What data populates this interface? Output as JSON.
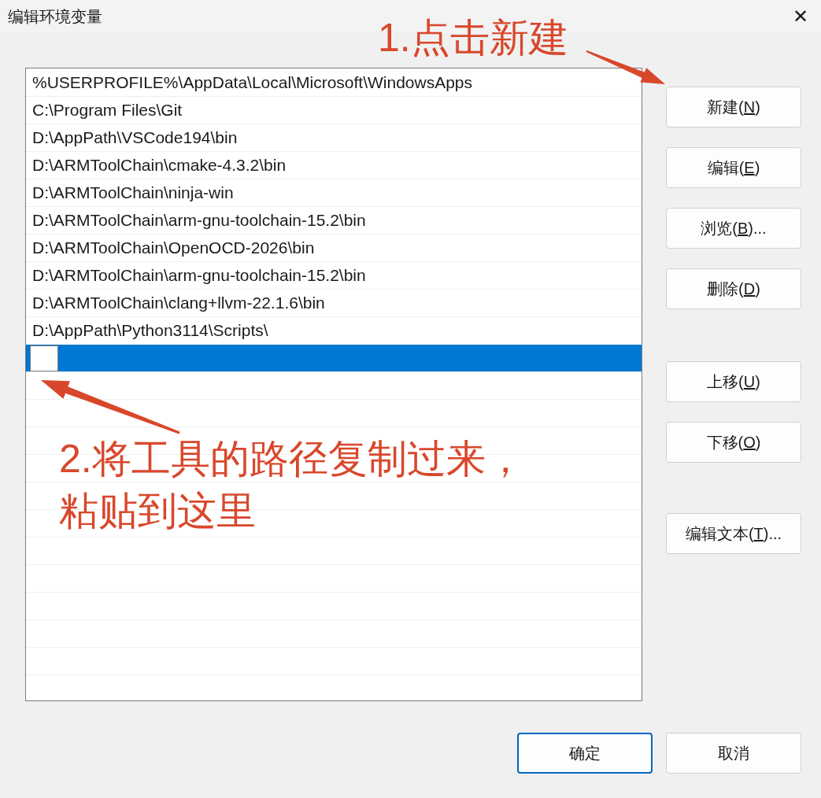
{
  "window": {
    "title": "编辑环境变量",
    "close_label": "✕"
  },
  "entries": [
    {
      "kind": "text",
      "text": "%USERPROFILE%\\AppData\\Local\\Microsoft\\WindowsApps",
      "selected": false
    },
    {
      "kind": "text",
      "text": "C:\\Program Files\\Git",
      "selected": false
    },
    {
      "kind": "text",
      "text": "D:\\AppPath\\VSCode194\\bin",
      "selected": false
    },
    {
      "kind": "text",
      "text": "D:\\ARMToolChain\\cmake-4.3.2\\bin",
      "selected": false
    },
    {
      "kind": "text",
      "text": "D:\\ARMToolChain\\ninja-win",
      "selected": false
    },
    {
      "kind": "text",
      "text": "D:\\ARMToolChain\\arm-gnu-toolchain-15.2\\bin",
      "selected": false
    },
    {
      "kind": "text",
      "text": "D:\\ARMToolChain\\OpenOCD-2026\\bin",
      "selected": false
    },
    {
      "kind": "text",
      "text": "D:\\ARMToolChain\\arm-gnu-toolchain-15.2\\bin",
      "selected": false
    },
    {
      "kind": "text",
      "text": "D:\\ARMToolChain\\clang+llvm-22.1.6\\bin",
      "selected": false
    },
    {
      "kind": "text",
      "text": "D:\\AppPath\\Python3114\\Scripts\\",
      "selected": false
    },
    {
      "kind": "editing",
      "selected": true
    }
  ],
  "side_buttons": [
    {
      "before": "新建(",
      "key": "N",
      "after": ")"
    },
    {
      "before": "编辑(",
      "key": "E",
      "after": ")"
    },
    {
      "before": "浏览(",
      "key": "B",
      "after": ")..."
    },
    {
      "before": "删除(",
      "key": "D",
      "after": ")"
    },
    {
      "before": "上移(",
      "key": "U",
      "after": ")"
    },
    {
      "before": "下移(",
      "key": "O",
      "after": ")"
    },
    {
      "before": "编辑文本(",
      "key": "T",
      "after": ")..."
    }
  ],
  "footer_buttons": [
    {
      "label": "确定",
      "default": true
    },
    {
      "label": "取消",
      "default": false
    }
  ],
  "annotations": [
    {
      "lines": [
        "1.点击新建"
      ]
    },
    {
      "lines": [
        "2.将工具的路径复制过来，",
        "粘贴到这里"
      ]
    }
  ]
}
